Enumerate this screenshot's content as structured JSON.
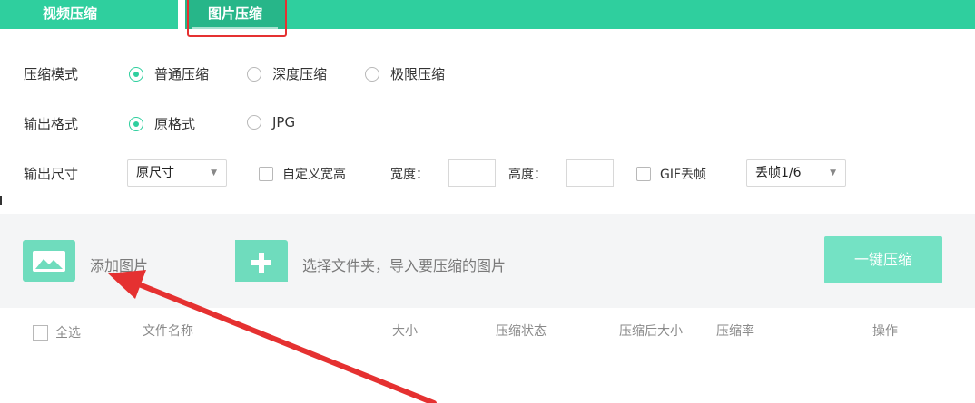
{
  "tabs": [
    {
      "label": "视频压缩",
      "active": false
    },
    {
      "label": "图片压缩",
      "active": true
    }
  ],
  "compress_mode": {
    "label": "压缩模式",
    "options": [
      "普通压缩",
      "深度压缩",
      "极限压缩"
    ],
    "selected": "普通压缩"
  },
  "output_format": {
    "label": "输出格式",
    "options": [
      "原格式",
      "JPG"
    ],
    "selected": "原格式"
  },
  "output_size": {
    "label": "输出尺寸",
    "size_select": "原尺寸",
    "custom_checkbox": "自定义宽高",
    "width_label": "宽度：",
    "width_value": "",
    "height_label": "高度：",
    "height_value": "",
    "gif_checkbox": "GIF丢帧",
    "frame_select": "丢帧1/6"
  },
  "actions": {
    "add_image": "添加图片",
    "add_folder": "选择文件夹，导入要压缩的图片",
    "one_key": "一键压缩"
  },
  "table": {
    "select_all": "全选",
    "columns": [
      "文件名称",
      "大小",
      "压缩状态",
      "压缩后大小",
      "压缩率",
      "操作"
    ]
  },
  "colors": {
    "accent": "#2fcf9e",
    "annotation": "#e53131"
  },
  "icons": {
    "add_image": "image-icon",
    "add_folder": "folder-plus-icon",
    "annotation_arrow": "arrow-annotation"
  }
}
